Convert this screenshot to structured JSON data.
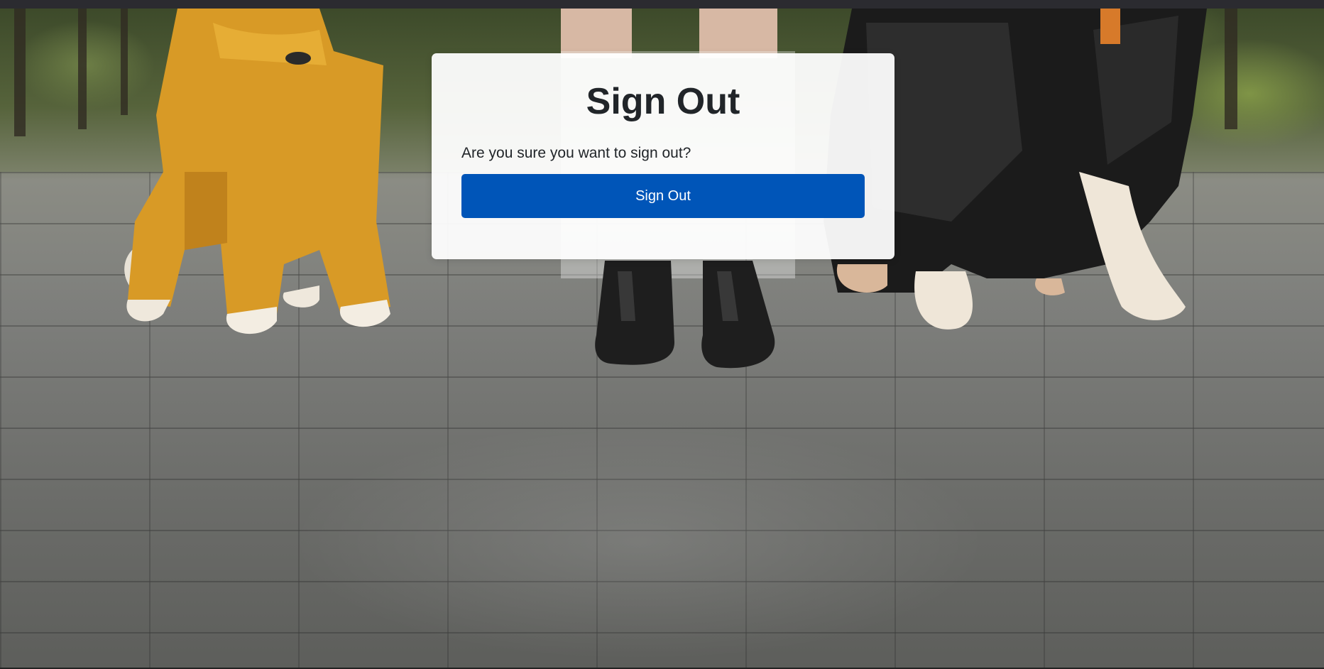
{
  "signout": {
    "title": "Sign Out",
    "question": "Are you sure you want to sign out?",
    "button_label": "Sign Out"
  },
  "colors": {
    "button_bg": "#0055b8",
    "button_text": "#ffffff",
    "card_bg": "#ffffff",
    "text": "#212529"
  },
  "background": {
    "description_icon": "photo-background"
  }
}
